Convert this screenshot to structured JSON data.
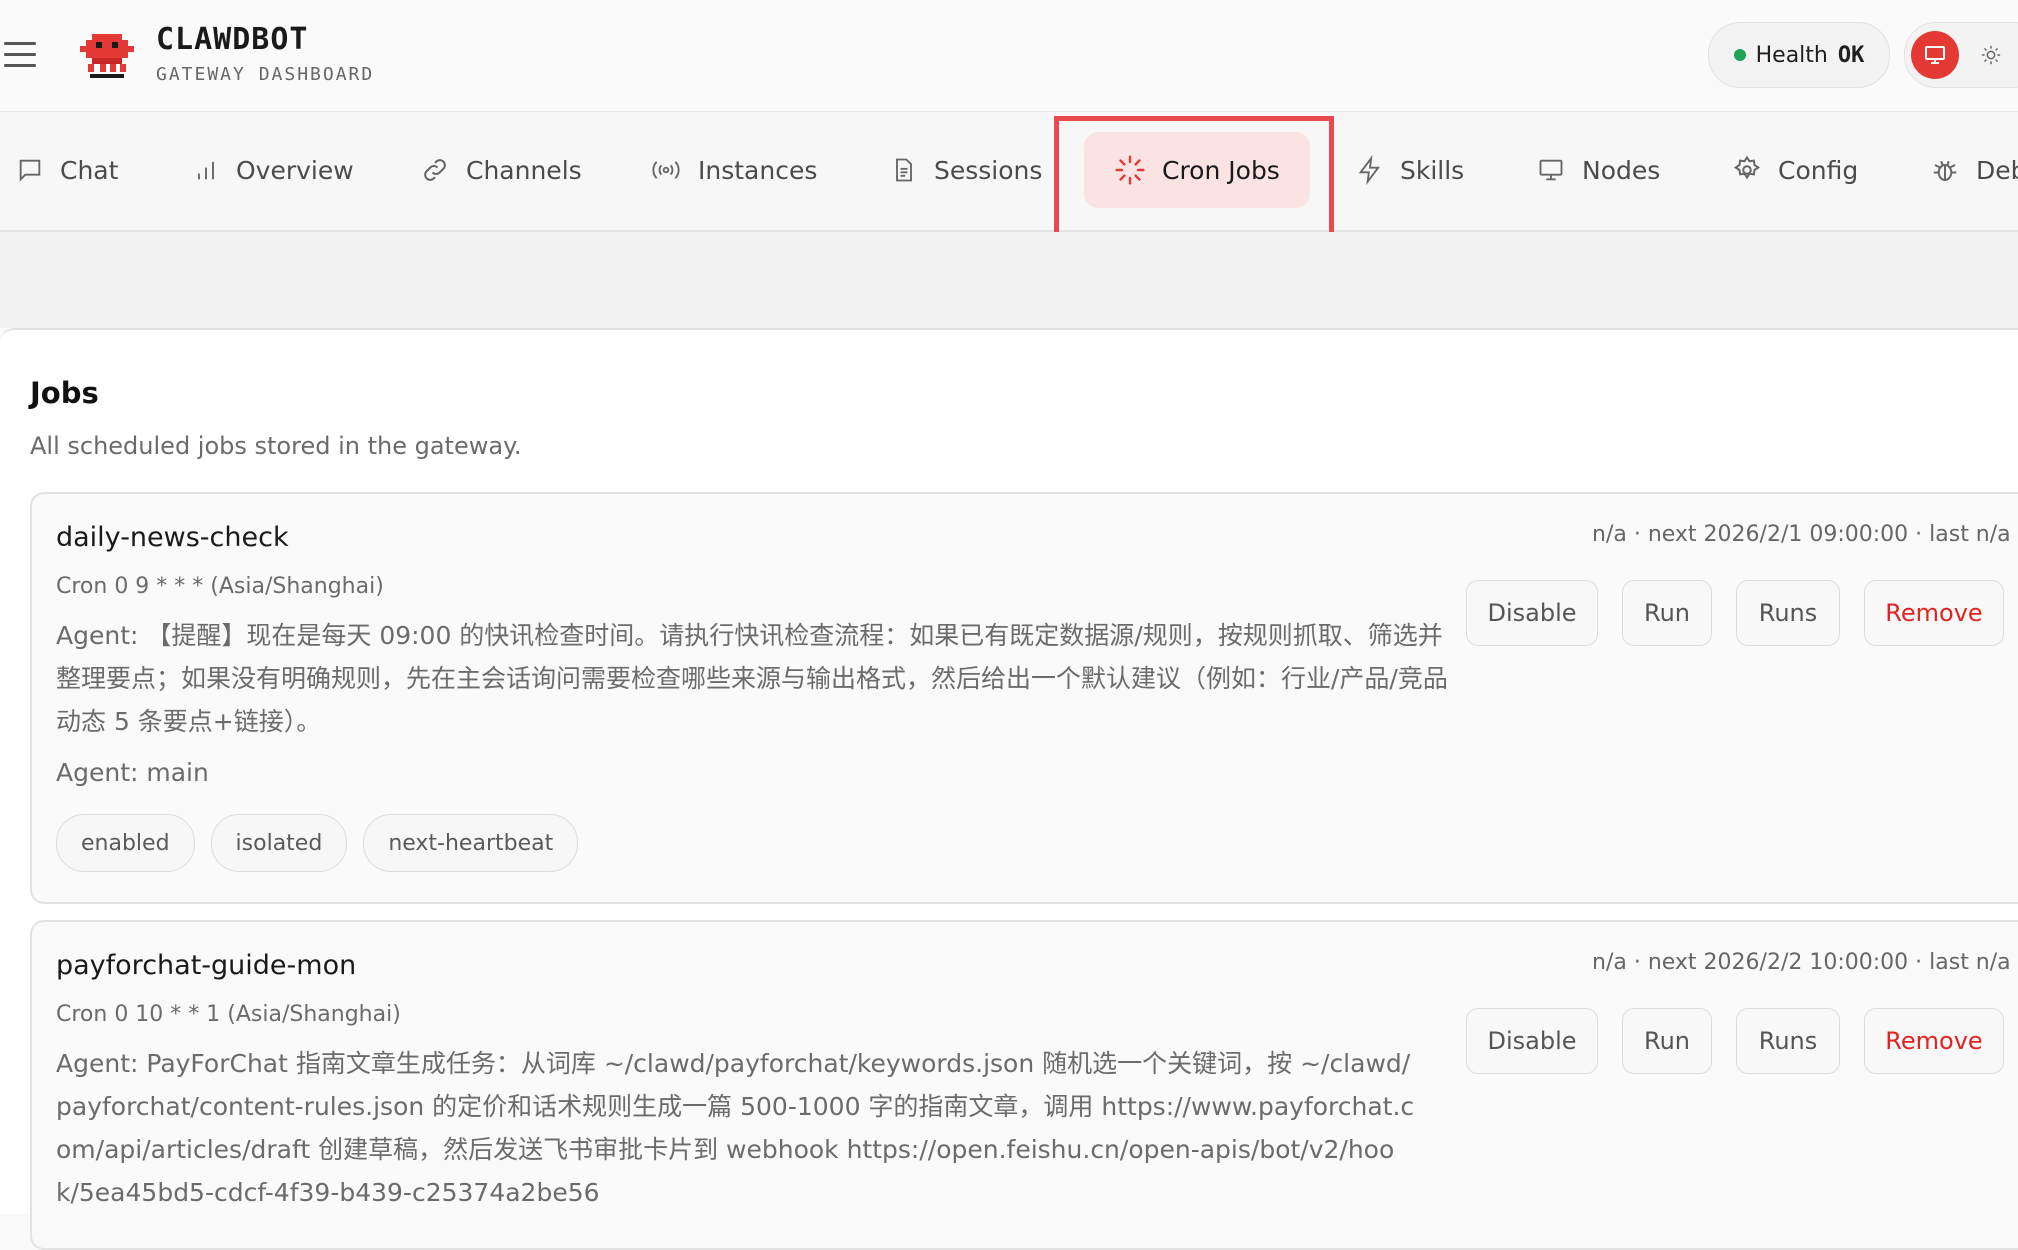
{
  "header": {
    "brand_title": "CLAWDBOT",
    "brand_subtitle": "GATEWAY DASHBOARD",
    "health_label": "Health",
    "health_value": "OK",
    "health_color": "#22a35a",
    "accent_color": "#e53935"
  },
  "tabs": [
    {
      "label": "Chat",
      "icon": "chat-icon"
    },
    {
      "label": "Overview",
      "icon": "bar-chart-icon"
    },
    {
      "label": "Channels",
      "icon": "link-icon"
    },
    {
      "label": "Instances",
      "icon": "radio-icon"
    },
    {
      "label": "Sessions",
      "icon": "document-icon"
    },
    {
      "label": "Cron Jobs",
      "icon": "spinner-icon",
      "active": true
    },
    {
      "label": "Skills",
      "icon": "lightning-icon"
    },
    {
      "label": "Nodes",
      "icon": "monitor-icon"
    },
    {
      "label": "Config",
      "icon": "gear-icon"
    },
    {
      "label": "Debug",
      "icon": "bug-icon"
    }
  ],
  "jobs_section": {
    "title": "Jobs",
    "subtitle": "All scheduled jobs stored in the gateway."
  },
  "jobs": [
    {
      "name": "daily-news-check",
      "meta": "n/a · next 2026/2/1 09:00:00 · last n/a",
      "cron": "Cron 0 9 * * * (Asia/Shanghai)",
      "agent_text": "Agent: 【提醒】现在是每天 09:00 的快讯检查时间。请执行快讯检查流程：如果已有既定数据源/规则，按规则抓取、筛选并整理要点；如果没有明确规则，先在主会话询问需要检查哪些来源与输出格式，然后给出一个默认建议（例如：行业/产品/竞品动态 5 条要点+链接）。",
      "agent_name": "Agent: main",
      "chips": [
        "enabled",
        "isolated",
        "next-heartbeat"
      ],
      "actions": {
        "disable": "Disable",
        "run": "Run",
        "runs": "Runs",
        "remove": "Remove"
      }
    },
    {
      "name": "payforchat-guide-mon",
      "meta": "n/a · next 2026/2/2 10:00:00 · last n/a",
      "cron": "Cron 0 10 * * 1 (Asia/Shanghai)",
      "agent_text": "Agent: PayForChat 指南文章生成任务：从词库 ~/clawd/payforchat/keywords.json 随机选一个关键词，按 ~/clawd/payforchat/content-rules.json 的定价和话术规则生成一篇 500-1000 字的指南文章，调用 https://www.payforchat.com/api/articles/draft 创建草稿，然后发送飞书审批卡片到 webhook https://open.feishu.cn/open-apis/bot/v2/hook/5ea45bd5-cdcf-4f39-b439-c25374a2be56",
      "actions": {
        "disable": "Disable",
        "run": "Run",
        "runs": "Runs",
        "remove": "Remove"
      }
    }
  ]
}
